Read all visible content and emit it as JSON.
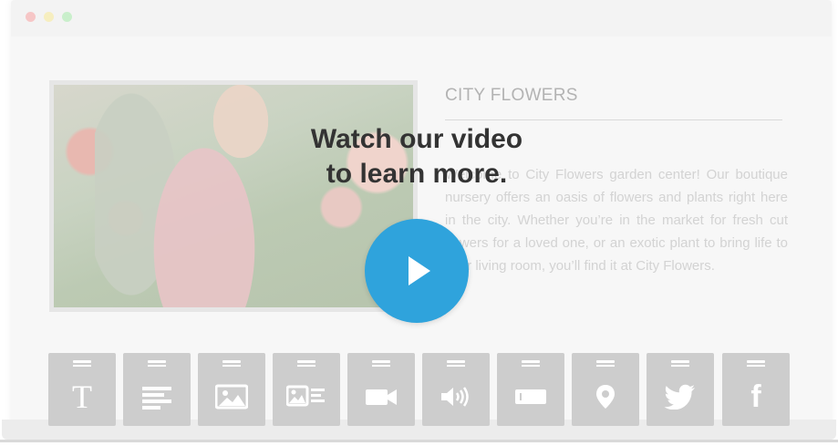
{
  "window": {
    "controls": [
      "close-dot",
      "minimize-dot",
      "maximize-dot"
    ]
  },
  "content": {
    "title": "CITY FLOWERS",
    "body": "Welcome to City Flowers garden center! Our boutique nursery offers an oasis of flowers and plants right here in the city. Whether you’re in the market for fresh cut flowers for a loved one, or an exotic plant to bring life to your living room, you’ll find it at City Flowers."
  },
  "overlay": {
    "headline_line1": "Watch our video",
    "headline_line2": "to learn more."
  },
  "colors": {
    "accent": "#2fa3dc",
    "tile": "#cdcdcd",
    "headline": "#333333"
  },
  "toolbar": {
    "tiles": [
      {
        "icon": "text-icon",
        "glyph": "T"
      },
      {
        "icon": "paragraph-icon"
      },
      {
        "icon": "image-icon"
      },
      {
        "icon": "image-text-icon"
      },
      {
        "icon": "video-icon"
      },
      {
        "icon": "audio-icon"
      },
      {
        "icon": "button-icon"
      },
      {
        "icon": "map-pin-icon"
      },
      {
        "icon": "twitter-icon"
      },
      {
        "icon": "facebook-icon",
        "glyph": "f"
      }
    ]
  }
}
